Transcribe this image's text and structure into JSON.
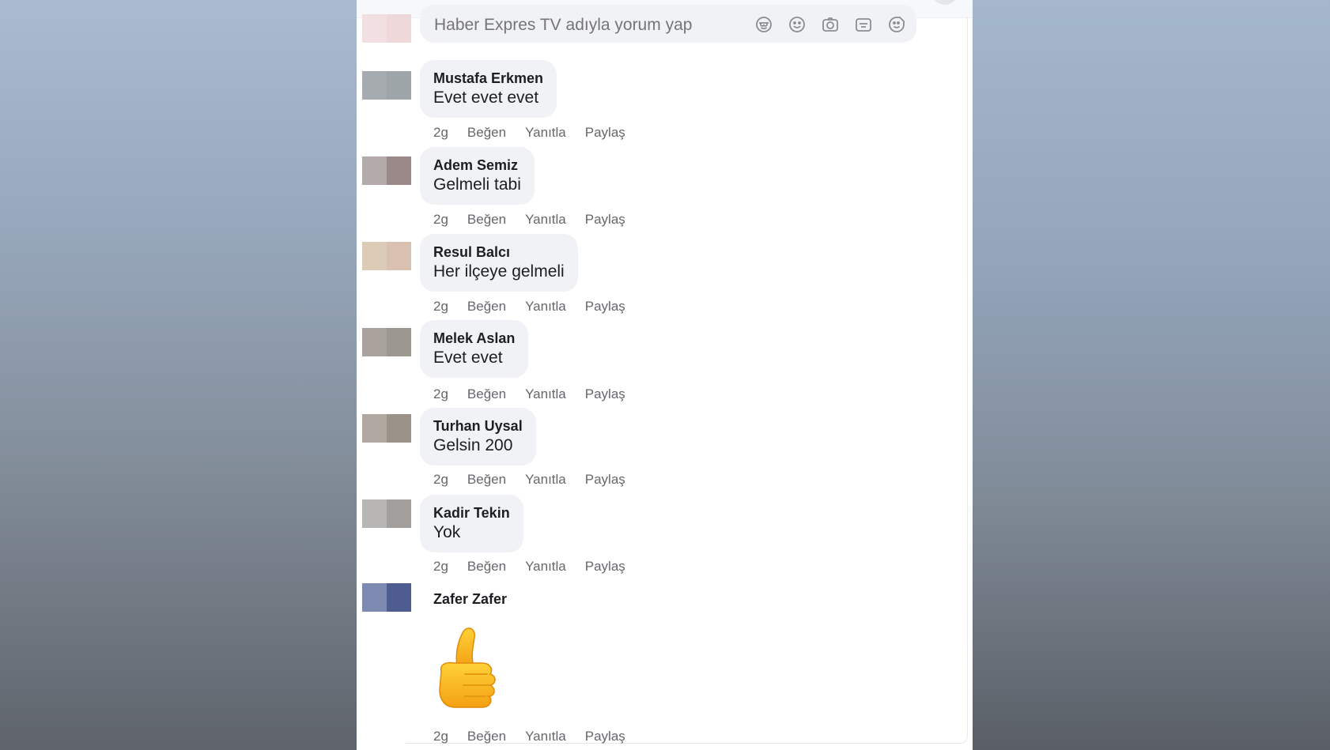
{
  "composer": {
    "placeholder": "Haber Expres TV adıyla yorum yap",
    "icons": [
      "emoji-face-icon",
      "smile-icon",
      "camera-icon",
      "gif-icon",
      "sticker-icon"
    ]
  },
  "actions": {
    "like": "Beğen",
    "reply": "Yanıtla",
    "share": "Paylaş"
  },
  "comments": [
    {
      "author": "Mustafa Erkmen",
      "text": "Evet evet evet",
      "time": "2g"
    },
    {
      "author": "Adem Semiz",
      "text": "Gelmeli tabi",
      "time": "2g"
    },
    {
      "author": "Resul Balcı",
      "text": "Her ilçeye gelmeli",
      "time": "2g"
    },
    {
      "author": "Melek Aslan",
      "text": "Evet evet",
      "time": "2g"
    },
    {
      "author": "Turhan Uysal",
      "text": "Gelsin 200",
      "time": "2g"
    },
    {
      "author": "Kadir Tekin",
      "text": "Yok",
      "time": "2g"
    },
    {
      "author": "Zafer Zafer",
      "text": "",
      "time": "2g",
      "content_type": "thumbs-up emoji"
    }
  ],
  "colors": {
    "bubble": "#f0f2f5",
    "author_text": "#1c1e21",
    "meta_text": "#65676b",
    "panel": "#ffffff"
  }
}
